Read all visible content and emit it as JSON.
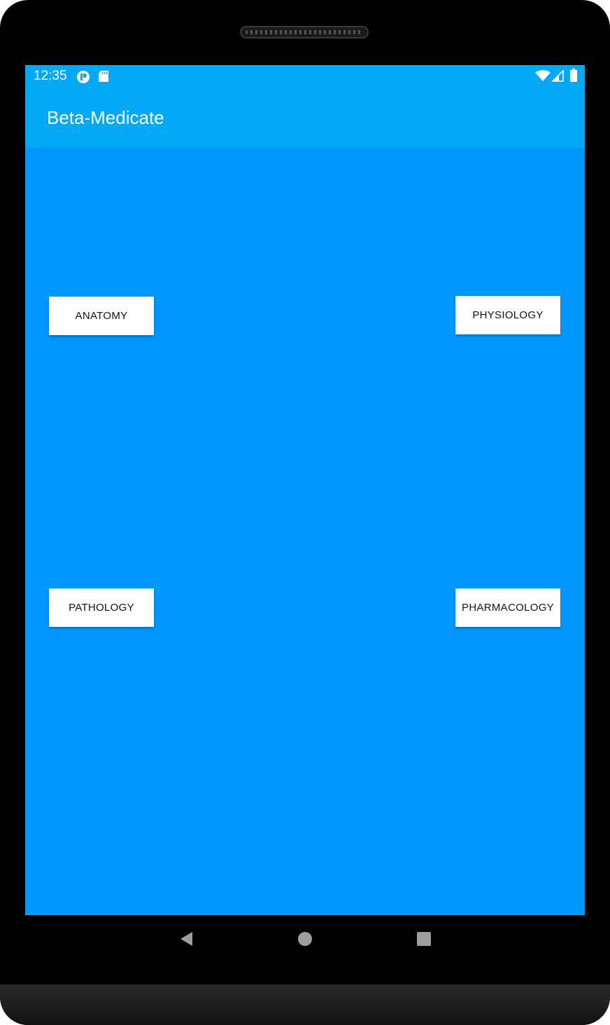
{
  "status_bar": {
    "time": "12:35",
    "left_icons": [
      "app-notification-icon",
      "sd-card-icon"
    ],
    "right_icons": [
      "wifi-icon",
      "cellular-signal-icon",
      "battery-icon"
    ]
  },
  "app_bar": {
    "title": "Beta-Medicate"
  },
  "buttons": {
    "anatomy": "ANATOMY",
    "physiology": "PHYSIOLOGY",
    "pathology": "PATHOLOGY",
    "pharmacology": "PHARMACOLOGY"
  },
  "nav_bar": {
    "icons": [
      "back-icon",
      "home-icon",
      "recents-icon"
    ]
  },
  "colors": {
    "status_bar": "#03a9f4",
    "app_bar": "#03a9f4",
    "content_background": "#0096ff",
    "button_background": "#ffffff",
    "button_text": "#111111"
  }
}
